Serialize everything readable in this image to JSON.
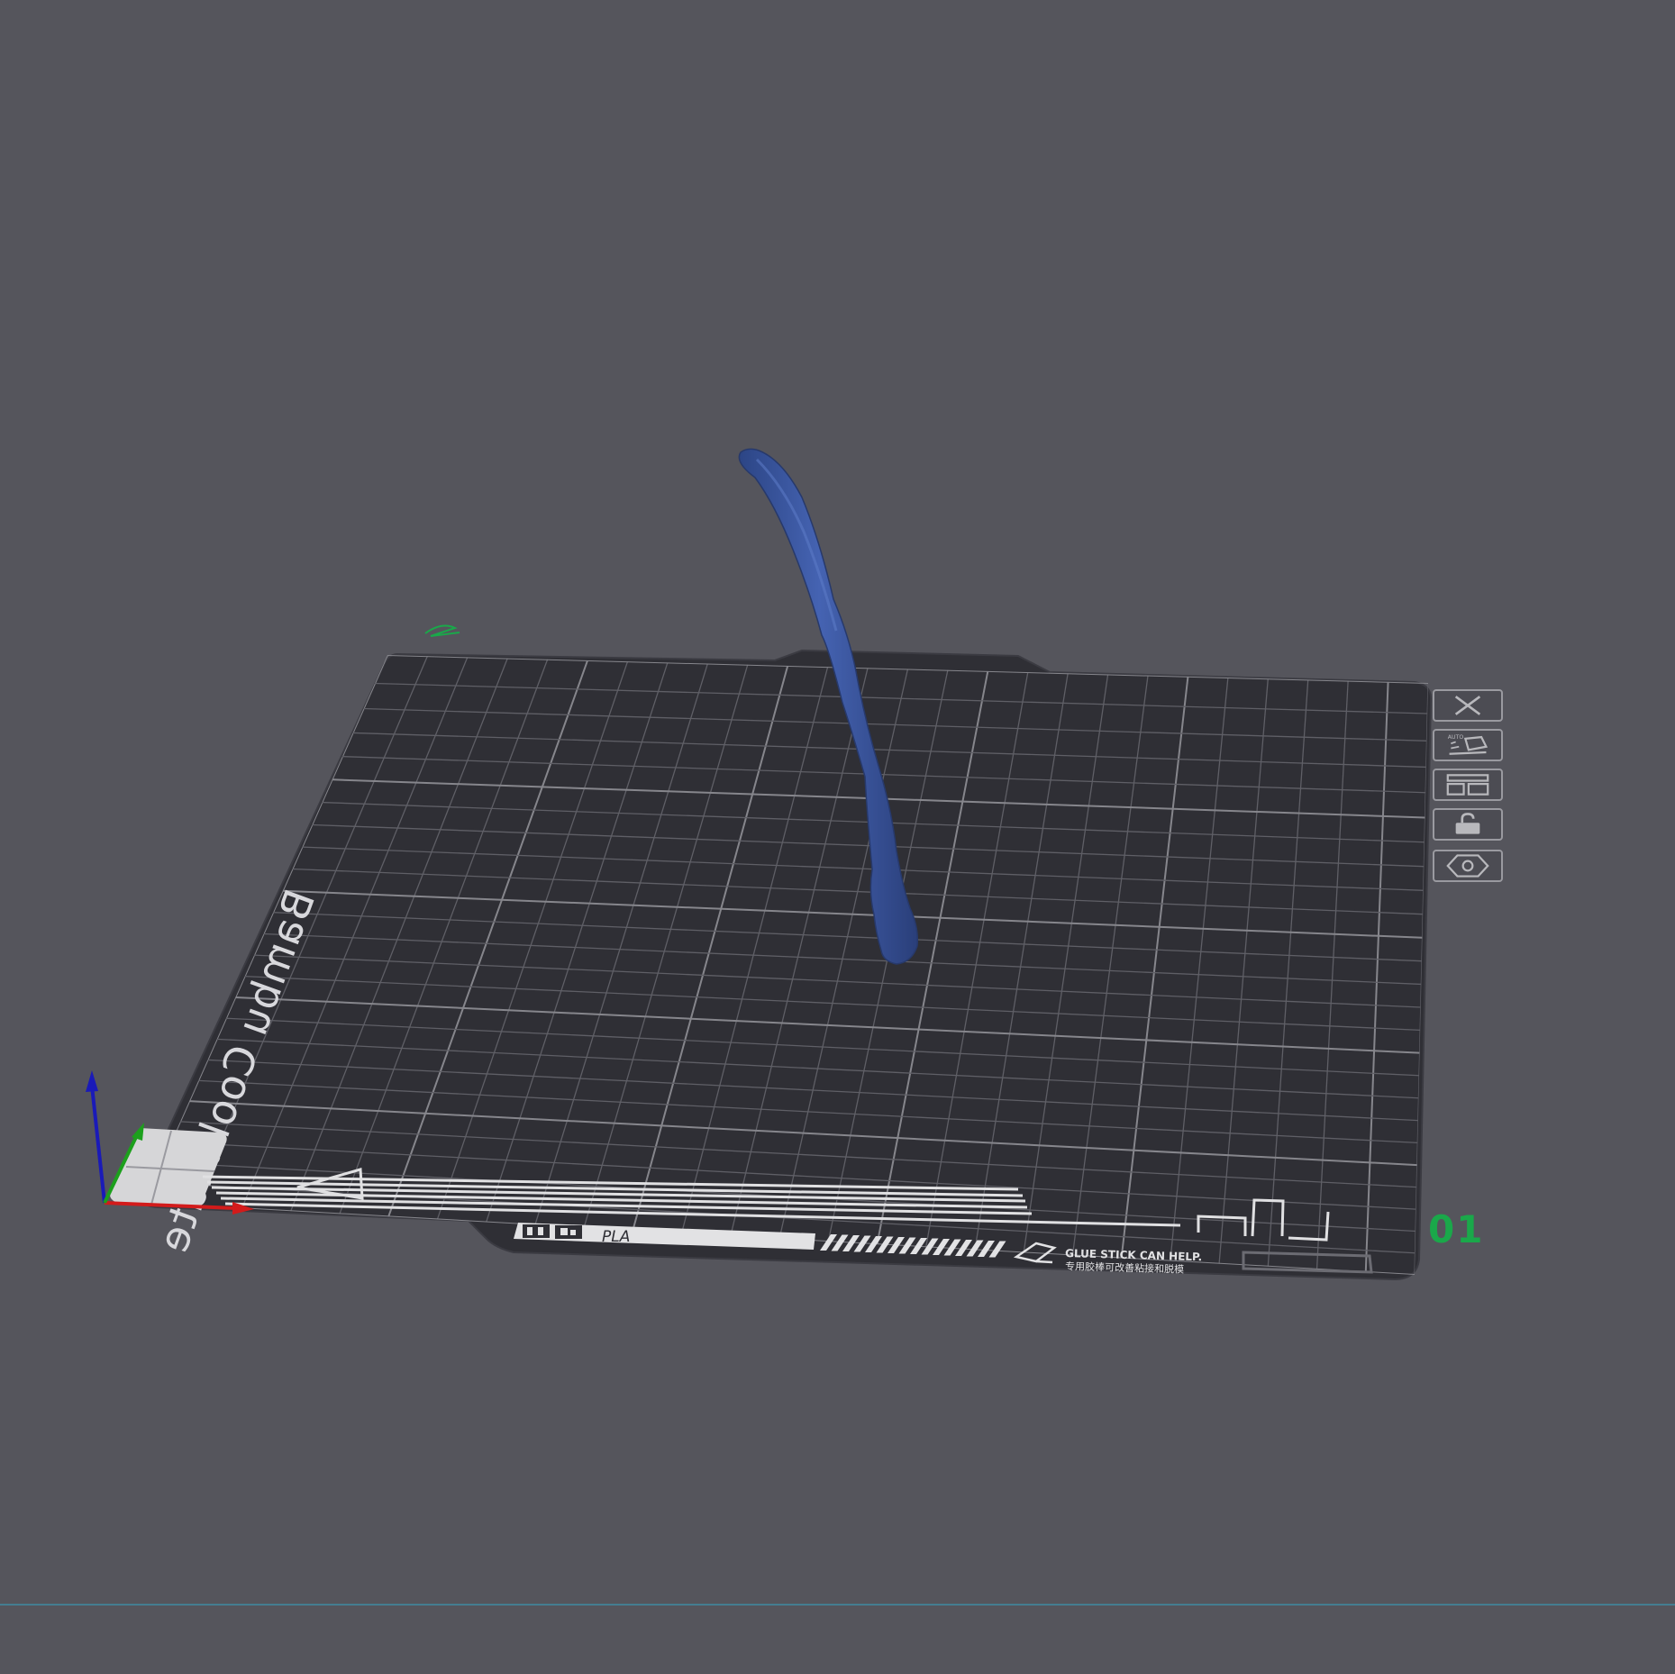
{
  "viewport": {
    "background": "#55555c"
  },
  "plate": {
    "name": "Bambu Cool Plate",
    "filament_label": "PLA",
    "tip_en": "GLUE STICK CAN HELP.",
    "tip_zh": "专用胶棒可改善粘接和脱模",
    "number": "01",
    "surface_color": "#2f2f35",
    "grid_color": "#6b6b72",
    "number_color": "#1aa84a"
  },
  "model": {
    "color": "#3a55a0"
  },
  "axes": {
    "x_color": "#d21b1b",
    "y_color": "#1ca01c",
    "z_color": "#1a1ab8"
  },
  "plate_tools": [
    {
      "name": "close-plate-button",
      "icon": "close-icon"
    },
    {
      "name": "auto-orient-button",
      "icon": "auto-orient-icon",
      "caption": "AUTO"
    },
    {
      "name": "arrange-button",
      "icon": "arrange-icon"
    },
    {
      "name": "lock-plate-button",
      "icon": "lock-icon"
    },
    {
      "name": "plate-settings-button",
      "icon": "gear-icon"
    }
  ]
}
